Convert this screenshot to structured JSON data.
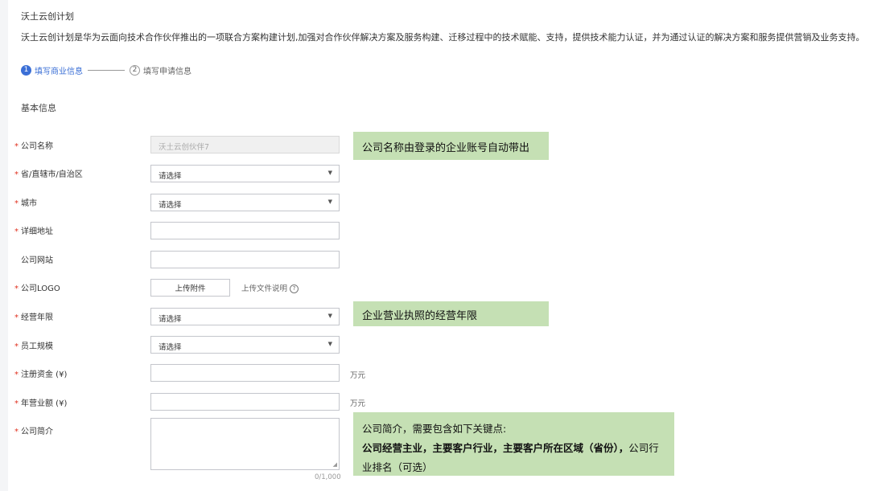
{
  "header": {
    "title": "沃土云创计划",
    "description": "沃土云创计划是华为云面向技术合作伙伴推出的一项联合方案构建计划,加强对合作伙伴解决方案及服务构建、迁移过程中的技术赋能、支持，提供技术能力认证，并为通过认证的解决方案和服务提供营销及业务支持。"
  },
  "steps": [
    {
      "number": "1",
      "label": "填写商业信息"
    },
    {
      "number": "2",
      "label": "填写申请信息"
    }
  ],
  "section_title": "基本信息",
  "required_mark": "*",
  "form": {
    "company_name": {
      "label": "公司名称",
      "value": "沃土云创伙伴7"
    },
    "province": {
      "label": "省/直辖市/自治区",
      "value": "请选择"
    },
    "city": {
      "label": "城市",
      "value": "请选择"
    },
    "address": {
      "label": "详细地址",
      "value": ""
    },
    "website": {
      "label": "公司网站",
      "value": ""
    },
    "logo": {
      "label": "公司LOGO",
      "button": "上传附件",
      "note": "上传文件说明",
      "help_icon": "?"
    },
    "operating_years": {
      "label": "经营年限",
      "value": "请选择"
    },
    "staff_size": {
      "label": "员工规模",
      "value": "请选择"
    },
    "registered_capital": {
      "label": "注册资金 (¥)",
      "value": "",
      "unit": "万元"
    },
    "annual_revenue": {
      "label": "年营业额 (¥)",
      "value": "",
      "unit": "万元"
    },
    "intro": {
      "label": "公司简介",
      "value": "",
      "counter": "0/1,000"
    }
  },
  "annotations": {
    "company_name_note": "公司名称由登录的企业账号自动带出",
    "years_note": "企业营业执照的经营年限",
    "intro_note_line1": "公司简介，需要包含如下关键点:",
    "intro_note_bold": "公司经营主业，主要客户行业，主要客户所在区域（省份），",
    "intro_note_rest": "公司行业排名（可选）"
  },
  "icons": {
    "select_caret": "▼",
    "resize_handle": "◢"
  },
  "colors": {
    "accent": "#3b6fd6",
    "required": "#e0301e",
    "note_background": "#c5e0b4"
  }
}
